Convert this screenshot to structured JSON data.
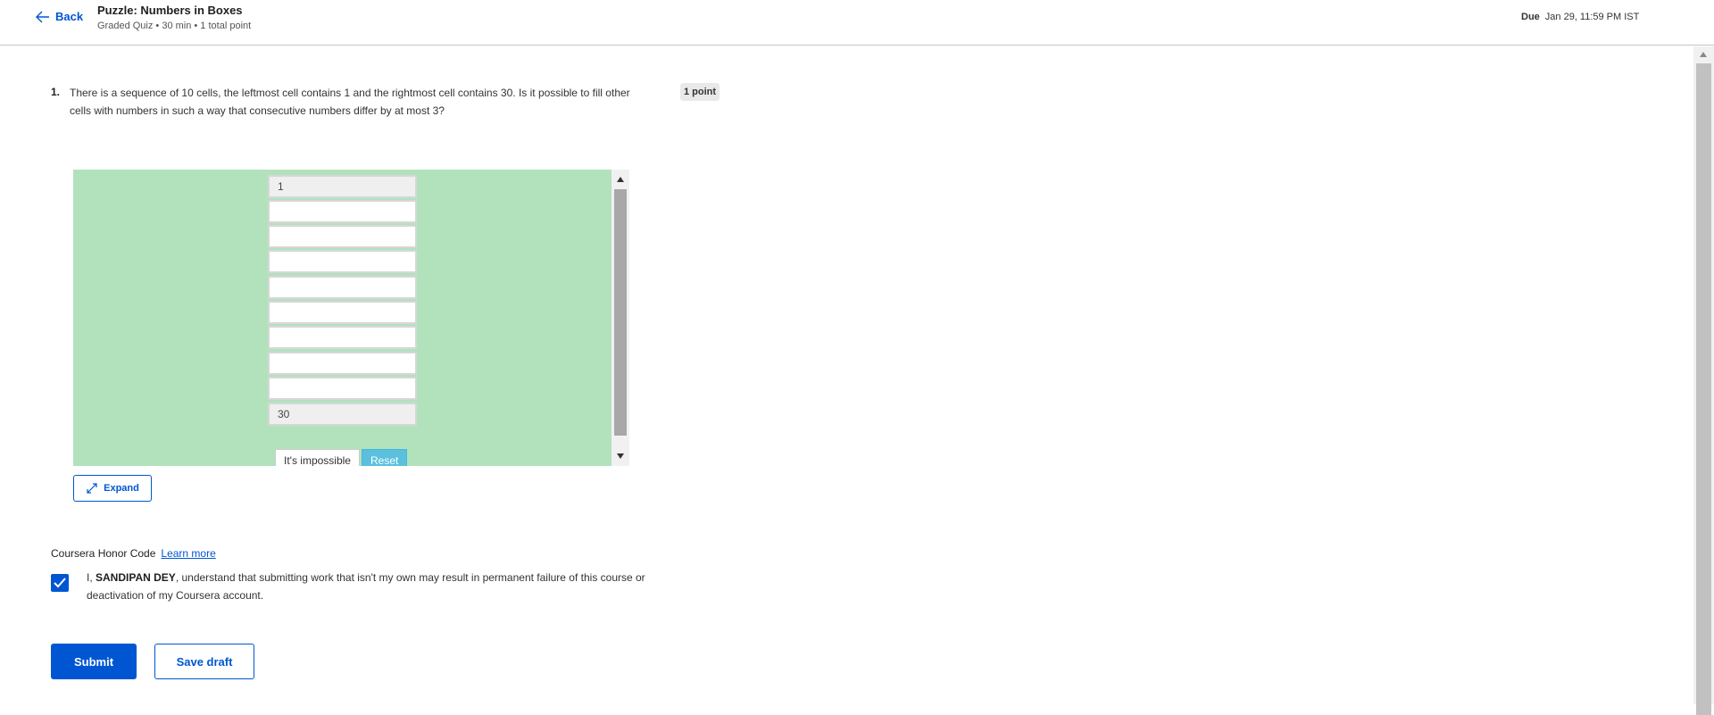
{
  "header": {
    "back_label": "Back",
    "title": "Puzzle: Numbers in Boxes",
    "meta": "Graded Quiz • 30 min • 1 total point",
    "due_label": "Due",
    "due_value": "Jan 29, 11:59 PM IST"
  },
  "question": {
    "number": "1.",
    "text": "There is a sequence of 10 cells, the leftmost cell contains 1 and the rightmost cell contains 30. Is it possible to fill other cells with numbers in such a way that consecutive numbers differ by at most 3?",
    "points": "1 point"
  },
  "puzzle": {
    "cells": [
      "1",
      "",
      "",
      "",
      "",
      "",
      "",
      "",
      "",
      "30"
    ],
    "impossible_label": "It's impossible",
    "reset_label": "Reset",
    "expand_label": "Expand"
  },
  "honor": {
    "title": "Coursera Honor Code",
    "learn_more": "Learn more",
    "prefix": "I, ",
    "name": "SANDIPAN DEY",
    "suffix": ", understand that submitting work that isn't my own may result in permanent failure of this course or deactivation of my Coursera account."
  },
  "actions": {
    "submit_label": "Submit",
    "save_label": "Save draft"
  },
  "colors": {
    "accent": "#0056d2",
    "frame_bg": "#b2e2bc",
    "reset_bg": "#5bc0de"
  }
}
